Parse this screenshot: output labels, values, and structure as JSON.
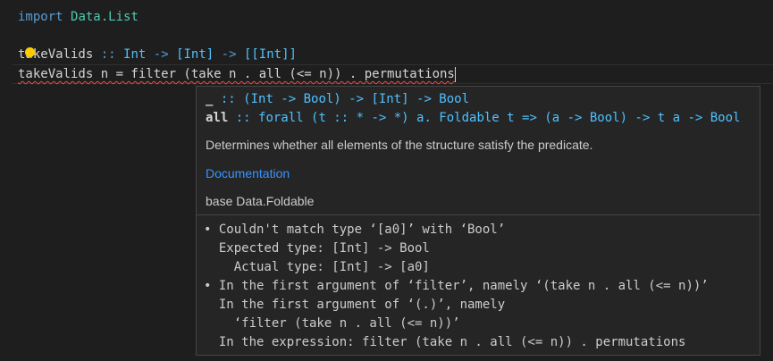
{
  "editor": {
    "line1": {
      "keyword": "import",
      "module": "Data.List"
    },
    "line3": {
      "name": "takeValids",
      "sep": "::",
      "t1": "Int",
      "arrow": "->",
      "t2": "[Int]",
      "t3": "[[Int]]"
    },
    "line4": {
      "text": "takeValids n = filter (take n . all (<= n)) . permutations"
    }
  },
  "hover": {
    "sig1": {
      "name": "_",
      "rest": " :: (Int -> Bool) -> [Int] -> Bool"
    },
    "sig2": {
      "name": "all",
      "rest": " :: forall (t :: * -> *) a. Foldable t => (a -> Bool) -> t a -> Bool"
    },
    "description": "Determines whether all elements of the structure satisfy the predicate.",
    "doc_link": "Documentation",
    "module": "base Data.Foldable",
    "diagnostic_lines": [
      "• Couldn't match type ‘[a0]’ with ‘Bool’",
      "  Expected type: [Int] -> Bool",
      "    Actual type: [Int] -> [a0]",
      "• In the first argument of ‘filter’, namely ‘(take n . all (<= n))’",
      "  In the first argument of ‘(.)’, namely",
      "    ‘filter (take n . all (<= n))’",
      "  In the expression: filter (take n . all (<= n)) . permutations"
    ]
  },
  "colors": {
    "background": "#1e1e1e",
    "keyword": "#569cd6",
    "type": "#4fc1ff",
    "link": "#3794ff",
    "error": "#f14c4c",
    "lightbulb": "#ffcc00"
  },
  "icons": {
    "lightbulb": "lightbulb-icon"
  }
}
